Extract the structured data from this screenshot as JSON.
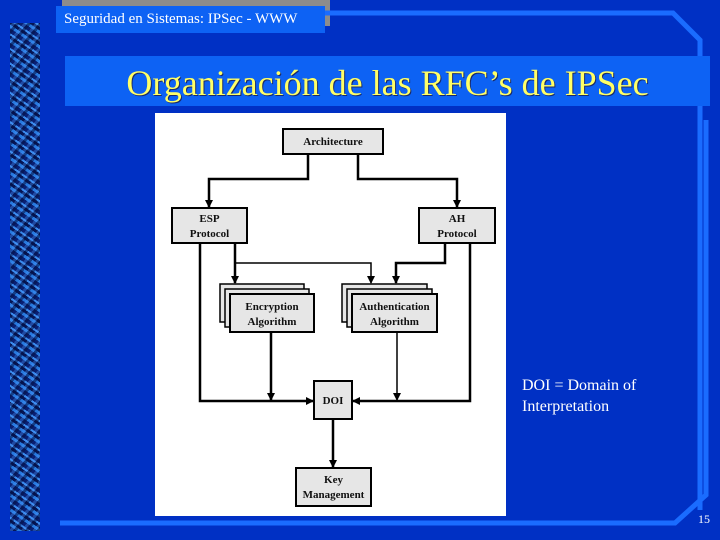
{
  "header": {
    "course_title": "Seguridad en Sistemas: IPSec - WWW"
  },
  "slide": {
    "title": "Organización de las RFC’s de IPSec",
    "note_lines": [
      "DOI = Domain of",
      "Interpretation"
    ],
    "page_number": "15"
  },
  "diagram": {
    "nodes": {
      "architecture": [
        "Architecture"
      ],
      "esp": [
        "ESP",
        "Protocol"
      ],
      "ah": [
        "AH",
        "Protocol"
      ],
      "encryption": [
        "Encryption",
        "Algorithm"
      ],
      "authentication": [
        "Authentication",
        "Algorithm"
      ],
      "doi": [
        "DOI"
      ],
      "key_management": [
        "Key",
        "Management"
      ]
    },
    "edges": [
      [
        "architecture",
        "esp"
      ],
      [
        "architecture",
        "ah"
      ],
      [
        "esp",
        "encryption"
      ],
      [
        "esp",
        "authentication"
      ],
      [
        "ah",
        "authentication"
      ],
      [
        "esp",
        "doi"
      ],
      [
        "encryption",
        "doi"
      ],
      [
        "authentication",
        "doi"
      ],
      [
        "ah",
        "doi"
      ],
      [
        "doi",
        "key_management"
      ]
    ]
  },
  "colors": {
    "background": "#0030c4",
    "band": "#0d62f4",
    "title_text": "#ffff66",
    "box_fill": "#e6e6e6"
  }
}
